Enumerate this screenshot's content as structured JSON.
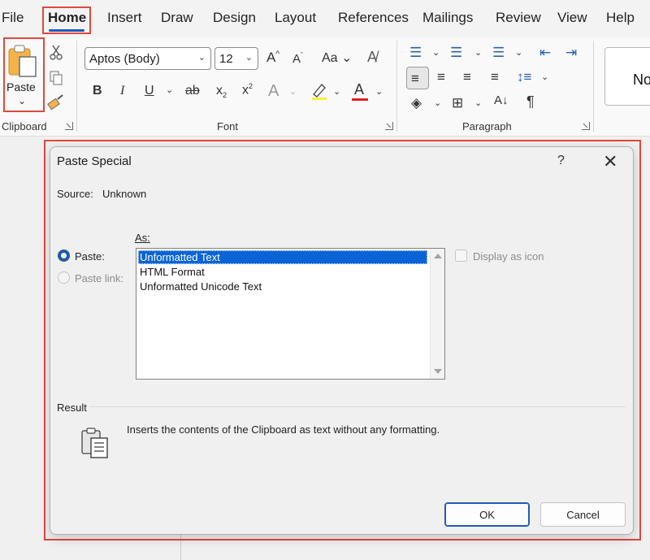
{
  "ribbon_tabs": [
    {
      "label": "File"
    },
    {
      "label": "Home"
    },
    {
      "label": "Insert"
    },
    {
      "label": "Draw"
    },
    {
      "label": "Design"
    },
    {
      "label": "Layout"
    },
    {
      "label": "References"
    },
    {
      "label": "Mailings"
    },
    {
      "label": "Review"
    },
    {
      "label": "View"
    },
    {
      "label": "Help"
    }
  ],
  "active_tab": "Home",
  "clipboard": {
    "paste_label": "Paste",
    "group_label": "Clipboard"
  },
  "font_group": {
    "font_name": "Aptos (Body)",
    "font_size": "12",
    "group_label": "Font"
  },
  "paragraph_group": {
    "group_label": "Paragraph"
  },
  "styles_preview": "No",
  "dialog": {
    "title": "Paste Special",
    "help": "?",
    "close": "✕",
    "source_label": "Source:",
    "source_value": "Unknown",
    "as_label": "As:",
    "paste_radio_label": "Paste:",
    "paste_link_radio_label": "Paste link:",
    "formats": [
      {
        "label": "Unformatted Text"
      },
      {
        "label": "HTML Format"
      },
      {
        "label": "Unformatted Unicode Text"
      }
    ],
    "selected_format": "Unformatted Text",
    "display_as_icon_label": "Display as icon",
    "result_label": "Result",
    "result_text": "Inserts the contents of the Clipboard as text without any formatting.",
    "ok_label": "OK",
    "cancel_label": "Cancel"
  },
  "colors": {
    "highlight_box": "#e0483c",
    "accent": "#1f5ab8",
    "selection": "#0a64d6"
  }
}
